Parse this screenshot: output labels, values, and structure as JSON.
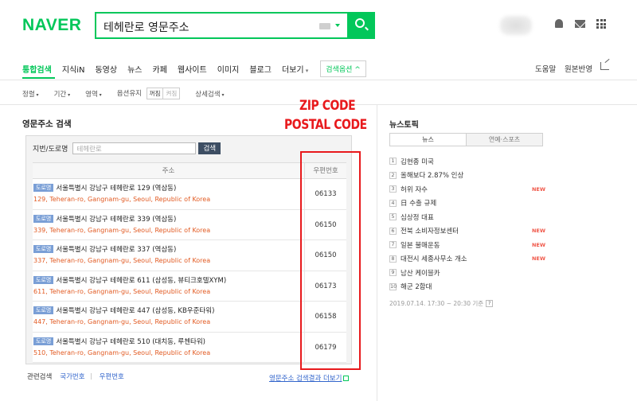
{
  "header": {
    "logo": "NAVER",
    "query": "테헤란로 영문주소"
  },
  "tabs": {
    "items": [
      "통합검색",
      "지식iN",
      "동영상",
      "뉴스",
      "카페",
      "웹사이트",
      "이미지",
      "블로그"
    ],
    "more": "더보기",
    "options": "검색옵션 ^",
    "help": "도움말",
    "feedback": "원본반영"
  },
  "filters": {
    "sort": "정렬",
    "period": "기간",
    "area": "영역",
    "keep_option": "옵션유지",
    "on": "꺼짐",
    "off": "켜짐",
    "detail": "상세검색"
  },
  "address_search": {
    "section_title": "영문주소 검색",
    "field_label": "지번/도로명",
    "placeholder": "테헤란로",
    "button": "검색",
    "col_address": "주소",
    "col_zip": "우편번호",
    "badge": "도로명",
    "rows": [
      {
        "kr": "서울특별시 강남구 테헤란로 129 (역삼동)",
        "en": "129, Teheran-ro, Gangnam-gu, Seoul, Republic of Korea",
        "zip": "06133"
      },
      {
        "kr": "서울특별시 강남구 테헤란로 339 (역삼동)",
        "en": "339, Teheran-ro, Gangnam-gu, Seoul, Republic of Korea",
        "zip": "06150"
      },
      {
        "kr": "서울특별시 강남구 테헤란로 337 (역삼동)",
        "en": "337, Teheran-ro, Gangnam-gu, Seoul, Republic of Korea",
        "zip": "06150"
      },
      {
        "kr": "서울특별시 강남구 테헤란로 611 (삼성동, 뷰티크호텔XYM)",
        "en": "611, Teheran-ro, Gangnam-gu, Seoul, Republic of Korea",
        "zip": "06173"
      },
      {
        "kr": "서울특별시 강남구 테헤란로 447 (삼성동, KB우준타워)",
        "en": "447, Teheran-ro, Gangnam-gu, Seoul, Republic of Korea",
        "zip": "06158"
      },
      {
        "kr": "서울특별시 강남구 테헤란로 510 (대치동, 루첸타워)",
        "en": "510, Teheran-ro, Gangnam-gu, Seoul, Republic of Korea",
        "zip": "06179"
      }
    ],
    "related_label": "관련검색",
    "related_links": [
      "국가번호",
      "우편번호"
    ],
    "more_link": "영문주소 검색결과 더보기"
  },
  "annotation": {
    "line1": "ZIP CODE",
    "line2": "POSTAL CODE",
    "color": "#e8191c"
  },
  "news_topic": {
    "title": "뉴스토픽",
    "tabs": [
      "뉴스",
      "연예·스포츠"
    ],
    "items": [
      {
        "num": "1",
        "text": "김현종 미국",
        "new": ""
      },
      {
        "num": "2",
        "text": "올해보다 2.87% 인상",
        "new": ""
      },
      {
        "num": "3",
        "text": "허위 자수",
        "new": "NEW"
      },
      {
        "num": "4",
        "text": "日 수출 규제",
        "new": ""
      },
      {
        "num": "5",
        "text": "심상정 대표",
        "new": ""
      },
      {
        "num": "6",
        "text": "전북 소비자정보센터",
        "new": "NEW"
      },
      {
        "num": "7",
        "text": "일본 불매운동",
        "new": "NEW"
      },
      {
        "num": "8",
        "text": "대전시 세종사무소 개소",
        "new": "NEW"
      },
      {
        "num": "9",
        "text": "남산 케이블카",
        "new": ""
      },
      {
        "num": "10",
        "text": "해군 2함대",
        "new": ""
      }
    ],
    "timestamp": "2019.07.14. 17:30 ~ 20:30 기준",
    "help": "?"
  },
  "colors": {
    "brand": "#03c75a",
    "link": "#3366cc",
    "english": "#e25b23"
  }
}
